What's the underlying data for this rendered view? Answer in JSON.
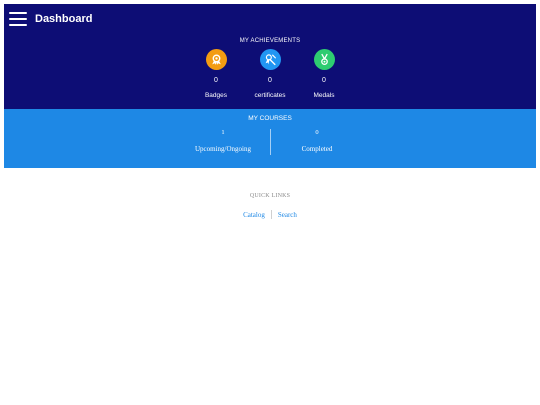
{
  "header": {
    "title": "Dashboard",
    "menu_icon": "hamburger-menu-icon"
  },
  "achievements": {
    "title": "MY ACHIEVEMENTS",
    "items": [
      {
        "label": "Badges",
        "count": "0",
        "icon": "badge-icon",
        "color": "#f39c12"
      },
      {
        "label": "certificates",
        "count": "0",
        "icon": "certificate-icon",
        "color": "#2196f3"
      },
      {
        "label": "Medals",
        "count": "0",
        "icon": "medal-icon",
        "color": "#2ecc71"
      }
    ]
  },
  "courses": {
    "title": "MY COURSES",
    "items": [
      {
        "label": "Upcoming/Ongoing",
        "count": "1"
      },
      {
        "label": "Completed",
        "count": "0"
      }
    ]
  },
  "quick_links": {
    "title": "QUICK LINKS",
    "items": [
      {
        "label": "Catalog"
      },
      {
        "label": "Search"
      }
    ]
  },
  "colors": {
    "header_bg": "#0d0d75",
    "courses_bg": "#1e88e5",
    "link": "#1e88e5"
  }
}
